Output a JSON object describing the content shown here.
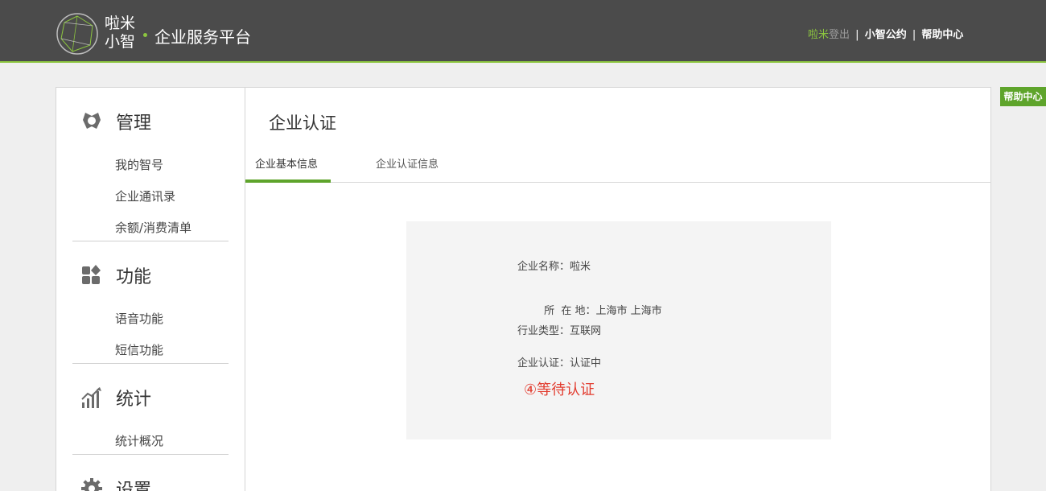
{
  "header": {
    "brand_line1": "啦米",
    "brand_line2": "小智",
    "platform": "企业服务平台",
    "user": "啦米",
    "logout": "登出",
    "sep": "|",
    "link_convention": "小智公约",
    "link_help": "帮助中心"
  },
  "float_help": "帮助中心",
  "sidebar": {
    "sections": [
      {
        "title": "管理",
        "icon": "manage-icon",
        "items": [
          "我的智号",
          "企业通讯录",
          "余额/消费清单"
        ]
      },
      {
        "title": "功能",
        "icon": "features-icon",
        "items": [
          "语音功能",
          "短信功能"
        ]
      },
      {
        "title": "统计",
        "icon": "stats-icon",
        "items": [
          "统计概况"
        ]
      },
      {
        "title": "设置",
        "icon": "gear-icon",
        "items": []
      }
    ]
  },
  "main": {
    "title": "企业认证",
    "tabs": [
      {
        "label": "企业基本信息",
        "active": true
      },
      {
        "label": "企业认证信息",
        "active": false
      }
    ],
    "info": [
      {
        "label": "企业名称：",
        "value": "啦米"
      },
      {
        "label": "所  在 地：",
        "value": "上海市 上海市"
      },
      {
        "label": "行业类型：",
        "value": "互联网"
      },
      {
        "label": "企业认证：",
        "value": "认证中"
      }
    ],
    "status_note": "④等待认证"
  },
  "colors": {
    "header_bg": "#4b4b4b",
    "accent_green": "#5ea42b",
    "status_red": "#e23b2e"
  }
}
